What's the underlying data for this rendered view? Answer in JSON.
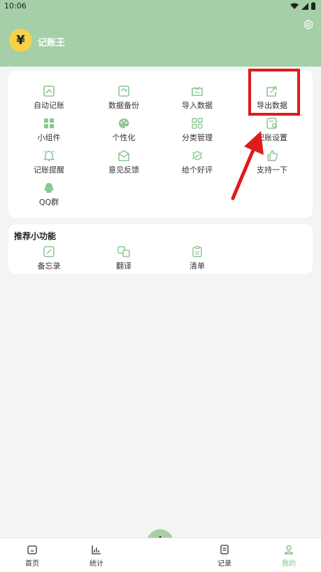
{
  "status": {
    "time": "10:06"
  },
  "user": {
    "name": "记账王",
    "avatar_glyph": "¥"
  },
  "colors": {
    "header": "#a5cfa6",
    "icon": "#8cc792",
    "active": "#7fbf86",
    "highlight": "#e01b1b"
  },
  "main_grid": [
    {
      "label": "自动记账",
      "icon": "auto-book-icon"
    },
    {
      "label": "数据备份",
      "icon": "backup-icon"
    },
    {
      "label": "导入数据",
      "icon": "import-icon"
    },
    {
      "label": "导出数据",
      "icon": "export-icon"
    },
    {
      "label": "小组件",
      "icon": "widget-icon"
    },
    {
      "label": "个性化",
      "icon": "palette-icon"
    },
    {
      "label": "分类管理",
      "icon": "category-icon"
    },
    {
      "label": "记账设置",
      "icon": "book-settings-icon"
    },
    {
      "label": "记账提醒",
      "icon": "bell-icon"
    },
    {
      "label": "意见反馈",
      "icon": "feedback-icon"
    },
    {
      "label": "给个好评",
      "icon": "rate-icon"
    },
    {
      "label": "支持一下",
      "icon": "thumbs-up-icon"
    },
    {
      "label": "QQ群",
      "icon": "qq-icon"
    }
  ],
  "mini_features": {
    "title": "推荐小功能",
    "items": [
      {
        "label": "备忘录",
        "icon": "memo-icon"
      },
      {
        "label": "翻译",
        "icon": "translate-icon"
      },
      {
        "label": "清单",
        "icon": "checklist-icon"
      }
    ]
  },
  "bottom_nav": [
    {
      "label": "首页",
      "icon": "home-icon"
    },
    {
      "label": "统计",
      "icon": "chart-icon"
    },
    {
      "label": "记录",
      "icon": "record-icon"
    },
    {
      "label": "我的",
      "icon": "profile-icon",
      "active": true
    }
  ]
}
